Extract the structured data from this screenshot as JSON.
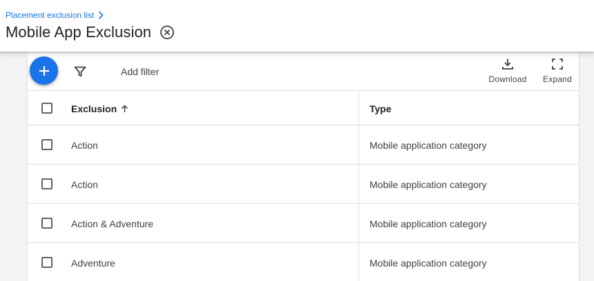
{
  "header": {
    "breadcrumb": "Placement exclusion list",
    "title": "Mobile App Exclusion"
  },
  "toolbar": {
    "add_filter": "Add filter",
    "download_label": "Download",
    "expand_label": "Expand"
  },
  "table": {
    "columns": [
      "Exclusion",
      "Type"
    ],
    "rows": [
      {
        "exclusion": "Action",
        "type": "Mobile application category"
      },
      {
        "exclusion": "Action",
        "type": "Mobile application category"
      },
      {
        "exclusion": "Action & Adventure",
        "type": "Mobile application category"
      },
      {
        "exclusion": "Adventure",
        "type": "Mobile application category"
      }
    ]
  },
  "colors": {
    "accent": "#1a73e8",
    "background": "#f1f3f4"
  },
  "icons": [
    "chevron-right-icon",
    "close-circle-icon",
    "plus-icon",
    "filter-icon",
    "download-icon",
    "expand-icon",
    "arrow-up-icon"
  ]
}
